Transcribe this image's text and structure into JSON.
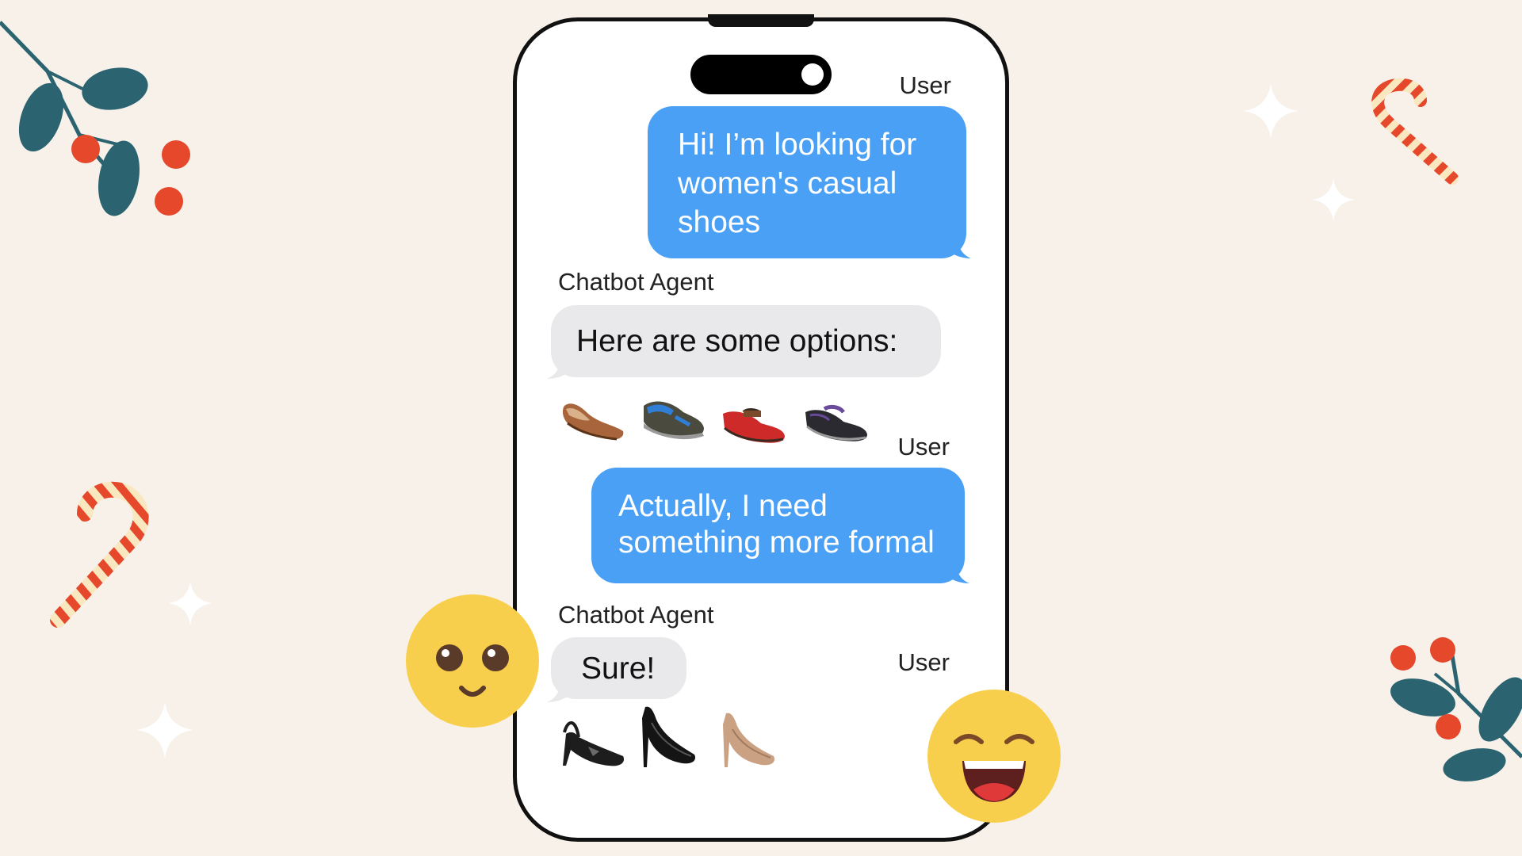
{
  "chat": {
    "messages": [
      {
        "sender": "User",
        "text_lines": [
          "Hi! I’m looking for",
          "women's casual",
          "shoes"
        ]
      },
      {
        "sender": "Chatbot Agent",
        "text": "Here are some options:"
      },
      {
        "sender": "User",
        "text_lines": [
          "Actually, I need",
          "something more formal"
        ]
      },
      {
        "sender": "Chatbot Agent",
        "text": "Sure!"
      },
      {
        "sender": "User"
      }
    ],
    "casual_shoes": [
      "flat-shoe-icon",
      "sneaker-icon",
      "red-mary-jane-icon",
      "black-mary-jane-icon"
    ],
    "formal_shoes": [
      "slingback-icon",
      "black-pump-icon",
      "nude-pump-icon"
    ]
  },
  "colors": {
    "background": "#f7f1ea",
    "user_bubble": "#4aa0f5",
    "bot_bubble": "#e9e9eb",
    "accent_red": "#e5482b",
    "leaf_teal": "#2b6470",
    "emoji_yellow": "#f8cf4c"
  }
}
